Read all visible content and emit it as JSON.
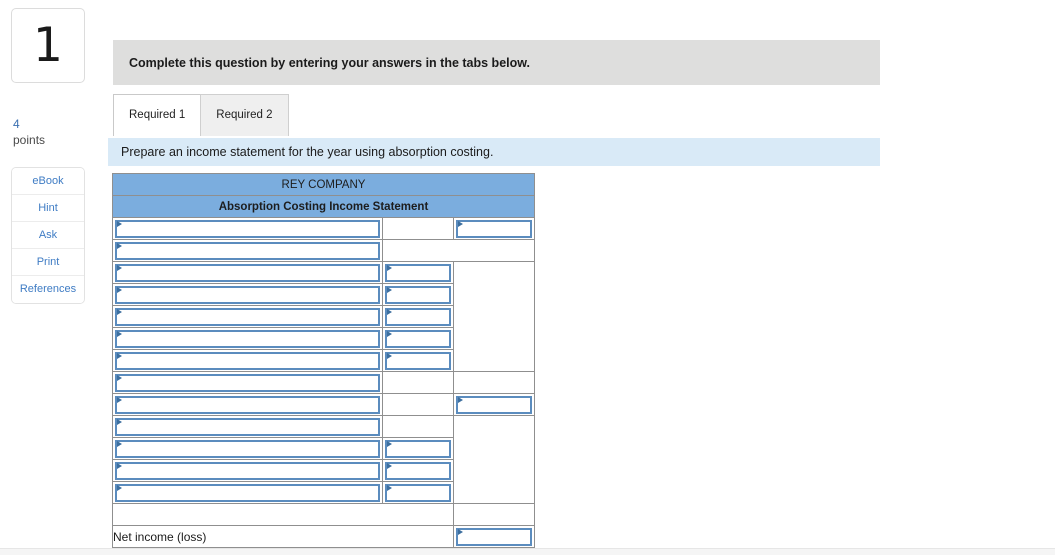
{
  "question": {
    "number": "1",
    "points_value": "4",
    "points_label": "points"
  },
  "tools": [
    {
      "label": "eBook",
      "name": "ebook"
    },
    {
      "label": "Hint",
      "name": "hint"
    },
    {
      "label": "Ask",
      "name": "ask"
    },
    {
      "label": "Print",
      "name": "print"
    },
    {
      "label": "References",
      "name": "references"
    }
  ],
  "instruction_banner": {
    "text": "Complete this question by entering your answers in the tabs below."
  },
  "tabs": [
    {
      "label": "Required 1",
      "active": true
    },
    {
      "label": "Required 2",
      "active": false
    }
  ],
  "prompt": {
    "text": "Prepare an income statement for the year using absorption costing."
  },
  "worksheet": {
    "company_title": "REY COMPANY",
    "statement_title": "Absorption Costing Income Statement",
    "net_income_label": "Net income (loss)",
    "rows": [
      {
        "label_value": "",
        "mid_value": "",
        "right_value": ""
      },
      {
        "label_value": "",
        "mid_value": "",
        "right_value": ""
      },
      {
        "label_value": "",
        "mid_value": "",
        "right_value": ""
      },
      {
        "label_value": "",
        "mid_value": "",
        "right_value": ""
      },
      {
        "label_value": "",
        "mid_value": "",
        "right_value": ""
      },
      {
        "label_value": "",
        "mid_value": "",
        "right_value": ""
      },
      {
        "label_value": "",
        "mid_value": "",
        "right_value": ""
      },
      {
        "label_value": "",
        "mid_value": "",
        "right_value": ""
      },
      {
        "label_value": "",
        "mid_value": "",
        "right_value": ""
      },
      {
        "label_value": "",
        "mid_value": "",
        "right_value": ""
      },
      {
        "label_value": "",
        "mid_value": "",
        "right_value": ""
      },
      {
        "label_value": "",
        "mid_value": "",
        "right_value": ""
      },
      {
        "label_value": "",
        "mid_value": "",
        "right_value": ""
      }
    ],
    "net_income_value": ""
  },
  "colors": {
    "header_blue": "#7badde",
    "prompt_blue": "#d9eaf7",
    "banner_gray": "#dededd",
    "input_border": "#5b8cbe",
    "link_blue": "#3f7cc4"
  }
}
